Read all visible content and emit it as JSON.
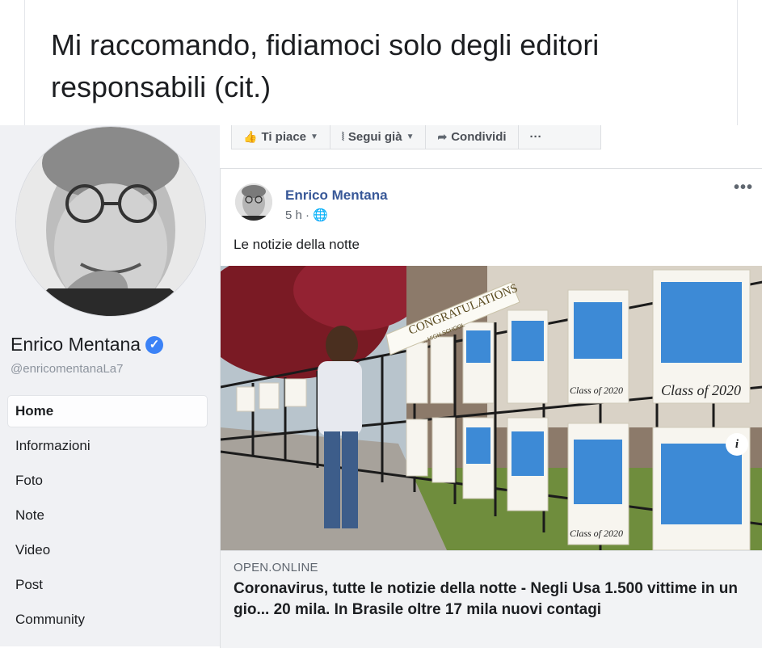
{
  "caption": "Mi raccomando, fidiamoci solo degli editori responsabili (cit.)",
  "sidebar": {
    "page_name": "Enrico Mentana",
    "handle": "@enricomentanaLa7",
    "nav": [
      "Home",
      "Informazioni",
      "Foto",
      "Note",
      "Video",
      "Post",
      "Community"
    ],
    "active": "Home"
  },
  "actions": {
    "like": "Ti piace",
    "follow": "Segui già",
    "share": "Condividi",
    "more": "···"
  },
  "post": {
    "author": "Enrico Mentana",
    "time": "5 h · ",
    "more": "•••",
    "text": "Le notizie della notte",
    "link": {
      "source": "OPEN.ONLINE",
      "title": "Coronavirus, tutte le notizie della notte - Negli Usa 1.500 vittime in un gio... 20 mila. In Brasile oltre 17 mila nuovi contagi"
    },
    "photo": {
      "banner": "CONGRATULATIONS",
      "banner_sub": "... HIGH SCHOOL",
      "year_label": "Class of 2020",
      "info": "i"
    }
  },
  "colors": {
    "link_blue": "#385898",
    "sidebar_bg": "#f0f1f4",
    "verified_blue": "#3b82f6"
  }
}
